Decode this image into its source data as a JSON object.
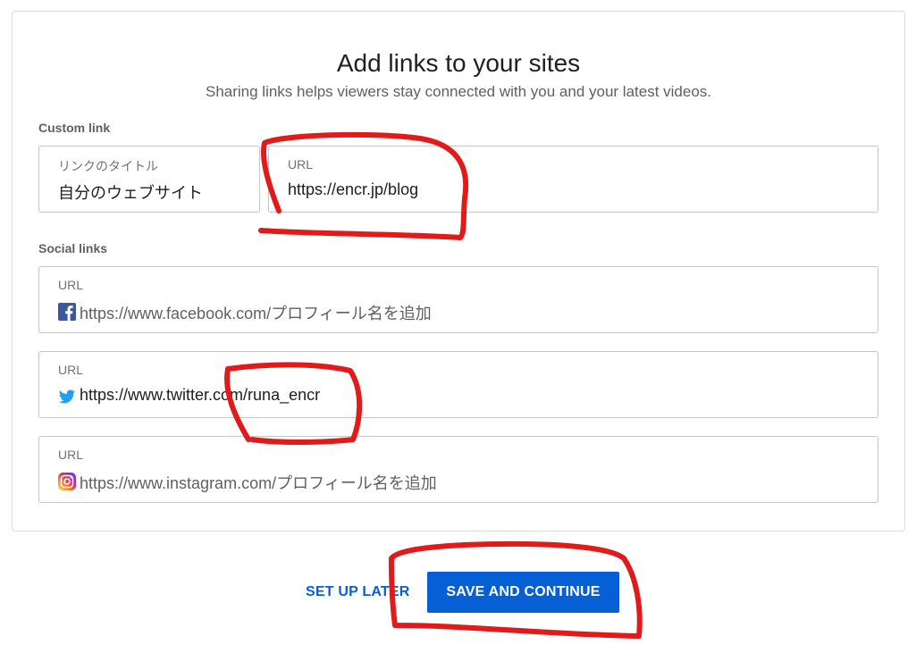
{
  "header": {
    "title": "Add links to your sites",
    "subtitle": "Sharing links helps viewers stay connected with you and your latest videos."
  },
  "custom_link": {
    "section_label": "Custom link",
    "title_field": {
      "label": "リンクのタイトル",
      "value": "自分のウェブサイト"
    },
    "url_field": {
      "label": "URL",
      "value": "https://encr.jp/blog"
    }
  },
  "social_links": {
    "section_label": "Social links",
    "items": [
      {
        "label": "URL",
        "value": "https://www.facebook.com/プロフィール名を追加",
        "icon": "facebook-icon"
      },
      {
        "label": "URL",
        "value": "https://www.twitter.com/runa_encr",
        "icon": "twitter-icon"
      },
      {
        "label": "URL",
        "value": "https://www.instagram.com/プロフィール名を追加",
        "icon": "instagram-icon"
      }
    ]
  },
  "actions": {
    "later_label": "SET UP LATER",
    "save_label": "SAVE AND CONTINUE"
  },
  "colors": {
    "accent": "#065fd4",
    "annotation": "#e01b1b",
    "facebook": "#3b5998",
    "twitter": "#1da1f2"
  }
}
